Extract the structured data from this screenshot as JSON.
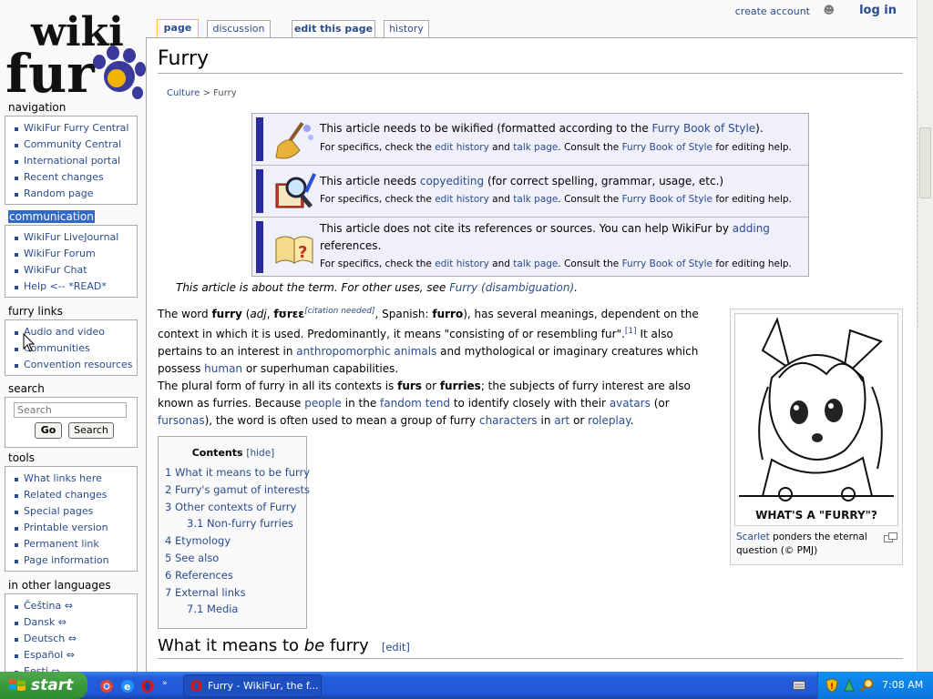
{
  "personal": {
    "create_account": "create account",
    "log_in": "log in"
  },
  "tabs": [
    "page",
    "discussion",
    "edit this page",
    "history"
  ],
  "logo_text": "wikifur",
  "sidebar": {
    "navigation": {
      "title": "navigation",
      "items": [
        "WikiFur Furry Central",
        "Community Central",
        "International portal",
        "Recent changes",
        "Random page"
      ]
    },
    "communication": {
      "title": "communication",
      "items": [
        "WikiFur LiveJournal",
        "WikiFur Forum",
        "WikiFur Chat",
        "Help <-- *READ*"
      ]
    },
    "furry_links": {
      "title": "furry links",
      "items": [
        "Audio and video",
        "Communities",
        "Convention resources"
      ]
    },
    "search": {
      "title": "search",
      "placeholder": "Search",
      "go": "Go",
      "search": "Search"
    },
    "tools": {
      "title": "tools",
      "items": [
        "What links here",
        "Related changes",
        "Special pages",
        "Printable version",
        "Permanent link",
        "Page information"
      ]
    },
    "languages": {
      "title": "in other languages",
      "items": [
        "Čeština ⇔",
        "Dansk ⇔",
        "Deutsch ⇔",
        "Español ⇔",
        "Eesti ⇔"
      ]
    }
  },
  "article": {
    "title": "Furry",
    "breadcrumb": {
      "parent": "Culture",
      "sep": " > ",
      "current": "Furry"
    },
    "notices": [
      {
        "pre": "This article needs to be wikified (formatted according to the ",
        "link": "Furry Book of Style",
        "post": ").",
        "pre2": "",
        "link2": "",
        "post2": "",
        "s_pre": "For specifics, check the ",
        "s_l1": "edit history",
        "s_and": " and ",
        "s_l2": "talk page",
        "s_mid": ". Consult the ",
        "s_l3": "Furry Book of Style",
        "s_post": " for editing help."
      },
      {
        "pre": "This article needs ",
        "link": "copyediting",
        "post": " (for correct spelling, grammar, usage, etc.)",
        "pre2": "",
        "link2": "",
        "post2": "",
        "s_pre": "For specifics, check the ",
        "s_l1": "edit history",
        "s_and": " and ",
        "s_l2": "talk page",
        "s_mid": ". Consult the ",
        "s_l3": "Furry Book of Style",
        "s_post": " for editing help."
      },
      {
        "pre": "This article does not cite its references or sources. You can help WikiFur by ",
        "link": "adding",
        "post": "",
        "line2": "references.",
        "s_pre": "For specifics, check the ",
        "s_l1": "edit history",
        "s_and": " and ",
        "s_l2": "talk page",
        "s_mid": ". Consult the ",
        "s_l3": "Furry Book of Style",
        "s_post": " for editing help."
      }
    ],
    "dab": {
      "text": "This article is about the term. For other uses, see ",
      "link": "Furry (disambiguation)",
      "end": "."
    },
    "p1": {
      "a": "The word ",
      "b": "furry",
      "c": " (",
      "d": "adj",
      "e": ", ",
      "f": "fʊrɛɛ",
      "g": "citation needed",
      "h": ", Spanish: ",
      "i": "furro",
      "j": "), has several meanings, dependent on the context in which it is used. Predominantly, it means \"consisting of or resembling fur\".",
      "k": "[1]",
      "l": " It also pertains to an interest in ",
      "m": "anthropomorphic animals",
      "n": " and mythological or imaginary creatures which possess ",
      "o": "human",
      "p": " or superhuman capabilities."
    },
    "p2": {
      "a": "The plural form of furry in all its contexts is ",
      "b": "furs",
      "c": " or ",
      "d": "furries",
      "e": "; the subjects of furry interest are also known as furries. Because ",
      "f": "people",
      "g": " in the ",
      "h": "fandom",
      "i": " ",
      "j": "tend",
      "k": " to identify closely with their ",
      "l": "avatars",
      "m": " (or ",
      "n": "fursonas",
      "o": "), the word is often used to mean a group of furry ",
      "p": "characters",
      "q": " in ",
      "r": "art",
      "s": " or ",
      "t": "roleplay",
      "u": "."
    },
    "thumb": {
      "caption_link": "Scarlet",
      "caption": " ponders the eternal question (© PMJ)",
      "image_text": "WHAT'S A \"FURRY\"?"
    },
    "toc": {
      "title": "Contents",
      "hide": "[hide]",
      "items": [
        "1 What it means to be furry",
        "2 Furry's gamut of interests",
        "3 Other contexts of Furry",
        "3.1 Non-furry furries",
        "4 Etymology",
        "5 See also",
        "6 References",
        "7 External links",
        "7.1 Media"
      ]
    },
    "section1": {
      "pre": "What it means to ",
      "em": "be",
      "post": " furry",
      "edit": "[edit]"
    }
  },
  "taskbar": {
    "start": "start",
    "window": "Furry - WikiFur, the f...",
    "clock": "7:08 AM"
  }
}
